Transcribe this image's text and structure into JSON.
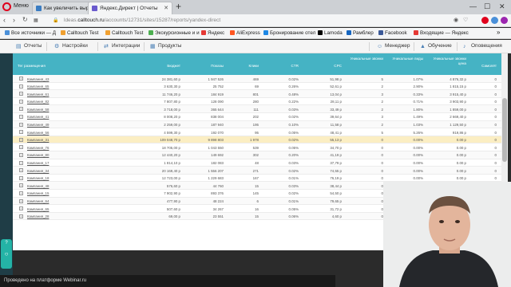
{
  "browser": {
    "menu_label": "Меню",
    "tabs": [
      {
        "label": "Как увеличить выручку с",
        "favicon_color": "#3a7cc2"
      },
      {
        "label": "Яндекс.Директ | Отчеты",
        "favicon_color": "#6a5acd"
      }
    ],
    "new_tab_symbol": "+",
    "url_prefix": "ldeas.",
    "url_host": "calltouch.ru",
    "url_path": "/accounts/12731/sites/15287/reports/yandex-direct"
  },
  "bookmarks": [
    {
      "label": "Все источники — Д",
      "color": "#4a90d9"
    },
    {
      "label": "Calltouch Test",
      "color": "#f0a030"
    },
    {
      "label": "Calltouch Test",
      "color": "#f0a030"
    },
    {
      "label": "Экскурсионные и и",
      "color": "#4caf50"
    },
    {
      "label": "Яндекс",
      "color": "#e53935"
    },
    {
      "label": "AliExpress",
      "color": "#ff5722"
    },
    {
      "label": "Бронирование отел",
      "color": "#1e88e5"
    },
    {
      "label": "Lamoda",
      "color": "#000000"
    },
    {
      "label": "Рамблер",
      "color": "#1565c0"
    },
    {
      "label": "Facebook",
      "color": "#3b5998"
    },
    {
      "label": "Входящие — Яндекс",
      "color": "#e53935"
    }
  ],
  "app_toolbar": {
    "left": [
      {
        "label": "Отчеты",
        "icon": "chart-icon"
      },
      {
        "label": "Настройки",
        "icon": "gear-icon"
      },
      {
        "label": "Интеграции",
        "icon": "plug-icon"
      },
      {
        "label": "Продукты",
        "icon": "box-icon"
      }
    ],
    "right": [
      {
        "label": "Менеджер",
        "icon": "person-icon"
      },
      {
        "label": "Обучение",
        "icon": "graduation-icon"
      },
      {
        "label": "Оповещения",
        "icon": "bell-icon"
      }
    ]
  },
  "table": {
    "columns": [
      "Тег размещения",
      "Бюджет",
      "Показы",
      "Клики",
      "CTR",
      "CPC",
      "Уникальные звонки",
      "Уникальные лиды",
      "Уникальные звонки цена",
      "Самолёт"
    ],
    "rows": [
      [
        "Кампания_43",
        "24 381,60 р",
        "1 947 526",
        "469",
        "0.02%",
        "51,98 р",
        "5",
        "1.07%",
        "4 876,32 р",
        "0"
      ],
      [
        "Кампания_65",
        "3 630,30 р",
        "25 752",
        "69",
        "0.26%",
        "52,61 р",
        "2",
        "2.90%",
        "1 815,15 р",
        "0"
      ],
      [
        "Кампания_61",
        "11 746,20 р",
        "184 919",
        "801",
        "0.48%",
        "13,04 р",
        "3",
        "0.33%",
        "3 915,40 р",
        "0"
      ],
      [
        "Кампания_82",
        "7 807,80 р",
        "128 090",
        "280",
        "0.22%",
        "28,11 р",
        "2",
        "0.71%",
        "3 903,90 р",
        "0"
      ],
      [
        "Кампания_58",
        "3 718,00 р",
        "365 644",
        "111",
        "0.03%",
        "33,49 р",
        "2",
        "1.80%",
        "1 859,00 р",
        "0"
      ],
      [
        "Кампания_41",
        "8 008,20 р",
        "838 004",
        "202",
        "0.02%",
        "39,64 р",
        "3",
        "1.49%",
        "2 669,40 р",
        "0"
      ],
      [
        "Кампания_49",
        "2 259,00 р",
        "187 940",
        "195",
        "0.10%",
        "11,58 р",
        "2",
        "1.03%",
        "1 129,50 р",
        "0"
      ],
      [
        "Кампания_56",
        "4 599,30 р",
        "192 070",
        "95",
        "0.05%",
        "48,41 р",
        "5",
        "5.26%",
        "919,86 р",
        "0"
      ],
      [
        "Кампания_31",
        "109 048,70 р",
        "9 898 803",
        "1 978",
        "0.02%",
        "55,13 р",
        "0",
        "0.00%",
        "0.00 р",
        "0"
      ],
      [
        "Кампания_76",
        "18 705,00 р",
        "1 043 550",
        "539",
        "0.05%",
        "34,70 р",
        "0",
        "0.00%",
        "0.00 р",
        "0"
      ],
      [
        "Кампания_80",
        "12 440,20 р",
        "149 692",
        "302",
        "0.20%",
        "41,19 р",
        "0",
        "0.00%",
        "0.00 р",
        "0"
      ],
      [
        "Кампания_17",
        "1 814,10 р",
        "182 083",
        "48",
        "0.03%",
        "37,79 р",
        "0",
        "0.00%",
        "0.00 р",
        "0"
      ],
      [
        "Кампания_34",
        "20 169,40 р",
        "1 556 207",
        "271",
        "0.02%",
        "74,55 р",
        "0",
        "0.00%",
        "0.00 р",
        "0"
      ],
      [
        "Кампания_18",
        "12 723,00 р",
        "1 229 683",
        "167",
        "0.01%",
        "76,19 р",
        "0",
        "0.00%",
        "0.00 р",
        "0"
      ],
      [
        "Кампания_48",
        "576,60 р",
        "44 760",
        "15",
        "0.03%",
        "38,44 р",
        "0",
        "0.00%",
        "0.00 р",
        "0"
      ],
      [
        "Кампания_15",
        "7 902,90 р",
        "893 376",
        "145",
        "0.02%",
        "54,50 р",
        "0",
        "0.00%",
        "0.00 р",
        "0"
      ],
      [
        "Кампания_64",
        "477,90 р",
        "48 224",
        "6",
        "0.01%",
        "79,65 р",
        "0",
        "0.00%",
        "0.00 р",
        "0"
      ],
      [
        "Кампания_65",
        "507,60 р",
        "34 267",
        "16",
        "0.05%",
        "31,72 р",
        "0",
        "0.00%",
        "0.00 р",
        "0"
      ],
      [
        "Кампания_28",
        "69,00 р",
        "23 551",
        "15",
        "0.06%",
        "4,60 р",
        "0",
        "0.00%",
        "0.00 р",
        "0"
      ]
    ],
    "highlight_row": 8,
    "header_color": "#45b3c4",
    "highlight_color": "#fbeec3"
  },
  "help_widget": {
    "label": "Помощь"
  },
  "footer": {
    "text": "Проведено на платформе Webinar.ru"
  }
}
